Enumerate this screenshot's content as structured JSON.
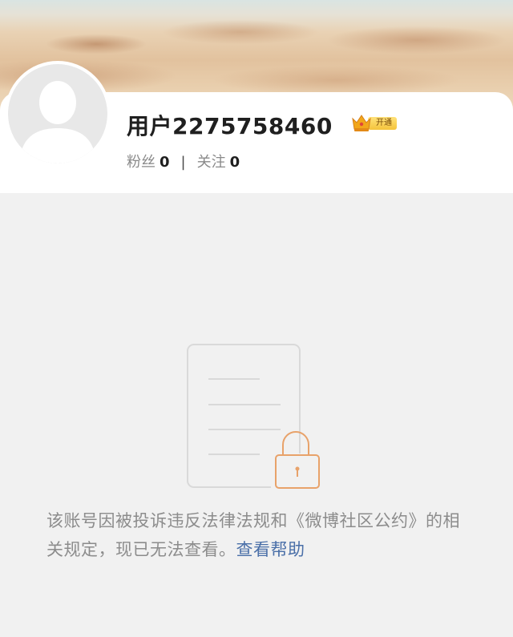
{
  "profile": {
    "username": "用户2275758460",
    "vip_label": "开通",
    "fans_label": "粉丝",
    "fans_count": "0",
    "follow_label": "关注",
    "follow_count": "0",
    "separator": "|"
  },
  "notice": {
    "text": "该账号因被投诉违反法律法规和《微博社区公约》的相关规定，现已无法查看。",
    "help_link": "查看帮助"
  },
  "colors": {
    "background": "#f1f1f1",
    "link": "#4a6fa8",
    "lock": "#e8a26a",
    "vip_gold": "#f5c33b"
  }
}
